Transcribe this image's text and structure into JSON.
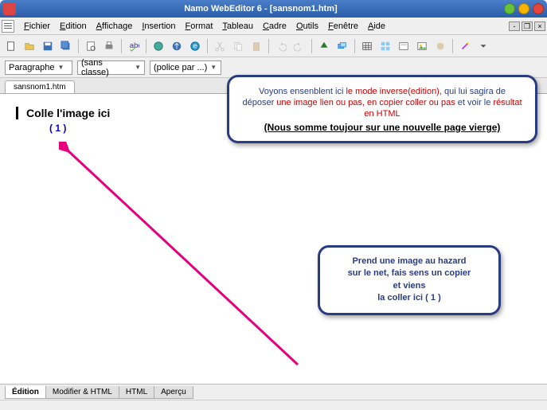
{
  "window": {
    "title": "Namo WebEditor 6 - [sansnom1.htm]"
  },
  "menu": {
    "fichier": "Fichier",
    "edition": "Edition",
    "affichage": "Affichage",
    "insertion": "Insertion",
    "format": "Format",
    "tableau": "Tableau",
    "cadre": "Cadre",
    "outils": "Outils",
    "fenetre": "Fenêtre",
    "aide": "Aide"
  },
  "format": {
    "paragraph": "Paragraphe",
    "class": "(sans classe)",
    "font": "(police par ...)"
  },
  "tab": {
    "filename": "sansnom1.htm"
  },
  "content": {
    "heading": "Colle l'image ici",
    "marker": "( 1 )"
  },
  "callout1": {
    "a": "Voyons ensenblent ici ",
    "b": "le mode inverse(edition)",
    "c": ", qui lui sagira de déposer ",
    "d": "une image lien ou pas, en copier coller ou pas ",
    "e": "et voir le ",
    "f": "résultat en HTML",
    "line2": "(Nous somme toujour sur une nouvelle page vierge)"
  },
  "callout2": {
    "l1": "Prend une image au hazard",
    "l2": "sur le net, fais sens un copier",
    "l3": "et viens",
    "l4": "la coller ici ( 1 )"
  },
  "bottomtabs": {
    "edition": "Édition",
    "modhtml": "Modifier & HTML",
    "html": "HTML",
    "apercu": "Aperçu"
  }
}
